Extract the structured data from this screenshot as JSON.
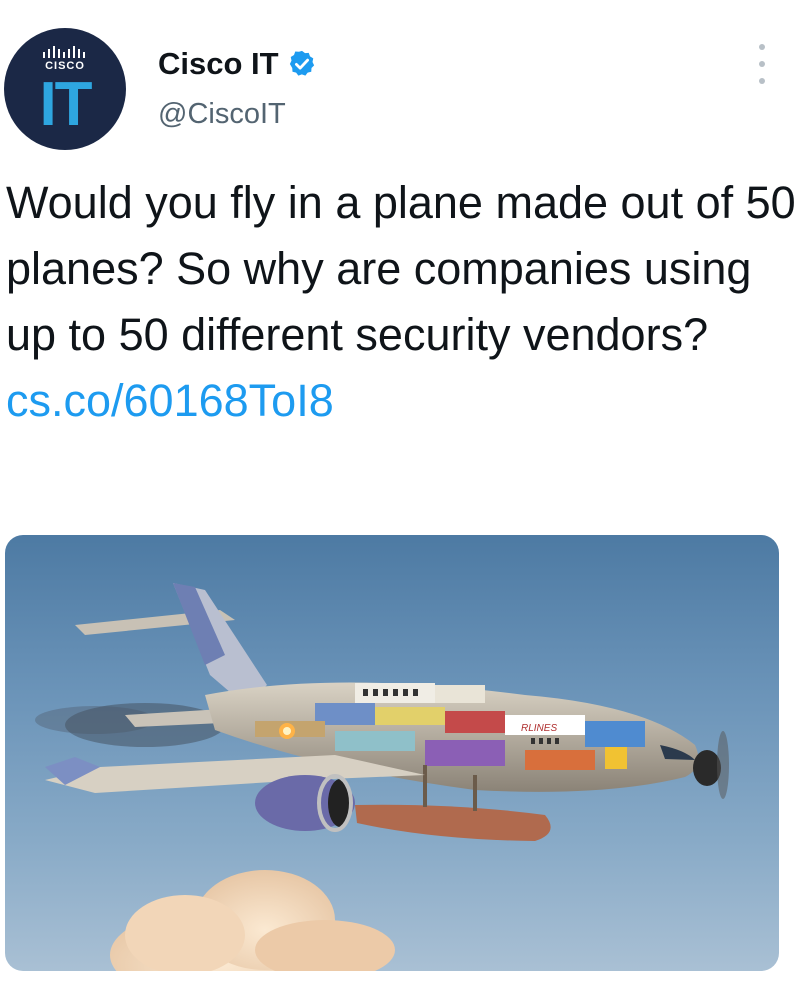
{
  "author": {
    "display_name": "Cisco IT",
    "handle": "@CiscoIT",
    "verified_icon": "verified-badge-icon",
    "avatar_logo_word": "CISCO",
    "avatar_initials": "IT"
  },
  "tweet": {
    "text": "Would you fly in a plane made out of 50 planes? So why are companies using up to 50 different security vendors? ",
    "link_text": "cs.co/60168ToI8"
  },
  "media": {
    "description_icon": "patchwork-airplane-image",
    "fuselage_text": "RLINES"
  },
  "colors": {
    "brand": "#1b2846",
    "accent_blue": "#1d9bf0",
    "avatar_it": "#2ea6e0",
    "handle_gray": "#536471"
  }
}
